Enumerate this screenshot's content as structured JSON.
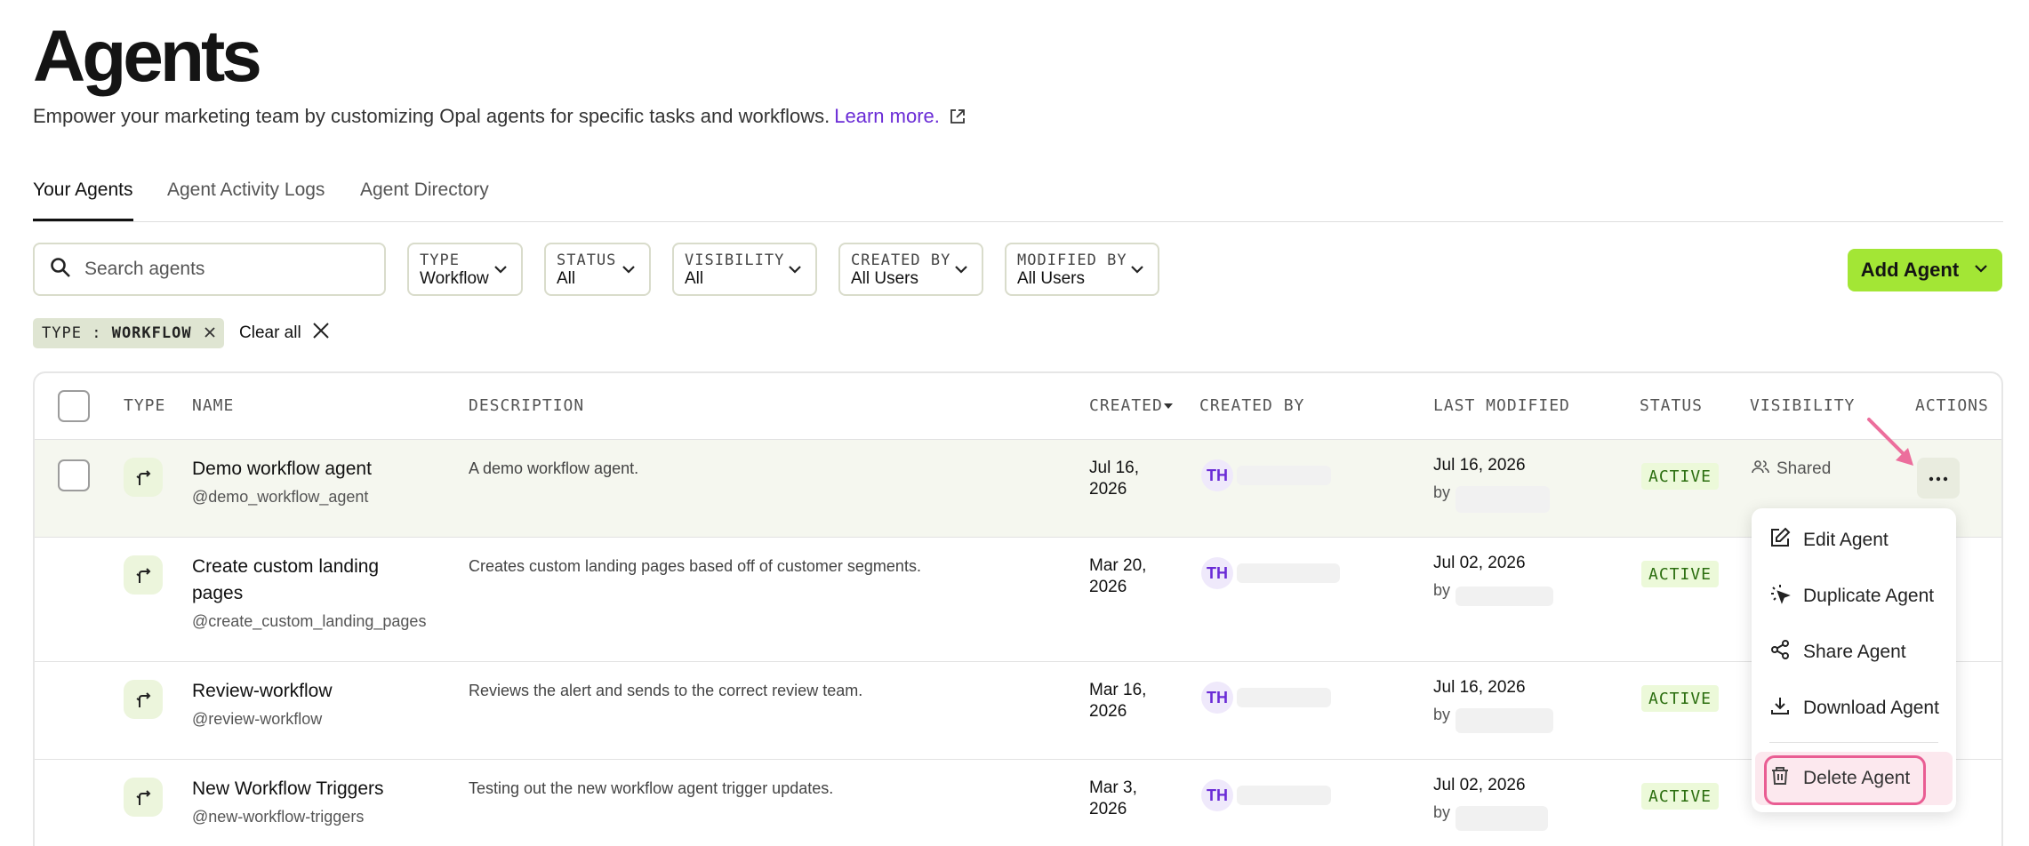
{
  "header": {
    "title": "Agents",
    "subtitle": "Empower your marketing team by customizing Opal agents for specific tasks and workflows.",
    "learn_more": "Learn more."
  },
  "tabs": [
    {
      "label": "Your Agents",
      "active": true
    },
    {
      "label": "Agent Activity Logs",
      "active": false
    },
    {
      "label": "Agent Directory",
      "active": false
    }
  ],
  "search": {
    "placeholder": "Search agents"
  },
  "filters": [
    {
      "label": "TYPE",
      "value": "Workflow"
    },
    {
      "label": "STATUS",
      "value": "All"
    },
    {
      "label": "VISIBILITY",
      "value": "All"
    },
    {
      "label": "CREATED BY",
      "value": "All Users"
    },
    {
      "label": "MODIFIED BY",
      "value": "All Users"
    }
  ],
  "add_agent": {
    "label": "Add Agent"
  },
  "active_filter_chip": {
    "key": "TYPE",
    "sep": ":",
    "value": "WORKFLOW"
  },
  "clear_all": "Clear all",
  "table": {
    "columns": {
      "type": "TYPE",
      "name": "NAME",
      "description": "DESCRIPTION",
      "created": "CREATED",
      "created_by": "CREATED BY",
      "last_modified": "LAST MODIFIED",
      "status": "STATUS",
      "visibility": "VISIBILITY",
      "actions": "ACTIONS"
    },
    "rows": [
      {
        "name": "Demo workflow agent",
        "handle": "@demo_workflow_agent",
        "description": "A demo workflow agent.",
        "created_1": "Jul 16,",
        "created_2": "2026",
        "initials": "TH",
        "modified": "Jul 16, 2026",
        "by": "by",
        "status": "ACTIVE",
        "visibility": "Shared"
      },
      {
        "name": "Create custom landing pages",
        "handle": "@create_custom_landing_pages",
        "description": "Creates custom landing pages based off of customer segments.",
        "created_1": "Mar 20,",
        "created_2": "2026",
        "initials": "TH",
        "modified": "Jul 02, 2026",
        "by": "by",
        "status": "ACTIVE"
      },
      {
        "name": "Review-workflow",
        "handle": "@review-workflow",
        "description": "Reviews the alert and sends to the correct review team.",
        "created_1": "Mar 16,",
        "created_2": "2026",
        "initials": "TH",
        "modified": "Jul 16, 2026",
        "by": "by",
        "status": "ACTIVE"
      },
      {
        "name": "New Workflow Triggers",
        "handle": "@new-workflow-triggers",
        "description": "Testing out the new workflow agent trigger updates.",
        "created_1": "Mar 3,",
        "created_2": "2026",
        "initials": "TH",
        "modified": "Jul 02, 2026",
        "by": "by",
        "status": "ACTIVE"
      }
    ]
  },
  "actions_menu": {
    "items": [
      {
        "label": "Edit Agent",
        "icon": "edit-icon"
      },
      {
        "label": "Duplicate Agent",
        "icon": "duplicate-icon"
      },
      {
        "label": "Share Agent",
        "icon": "share-icon"
      },
      {
        "label": "Download Agent",
        "icon": "download-icon"
      },
      {
        "label": "Delete Agent",
        "icon": "trash-icon"
      }
    ]
  },
  "colors": {
    "accent_green": "#a3e635",
    "link_purple": "#6a2bd6",
    "highlight_pink": "#e95d93",
    "status_green_bg": "#ecf9d9"
  }
}
